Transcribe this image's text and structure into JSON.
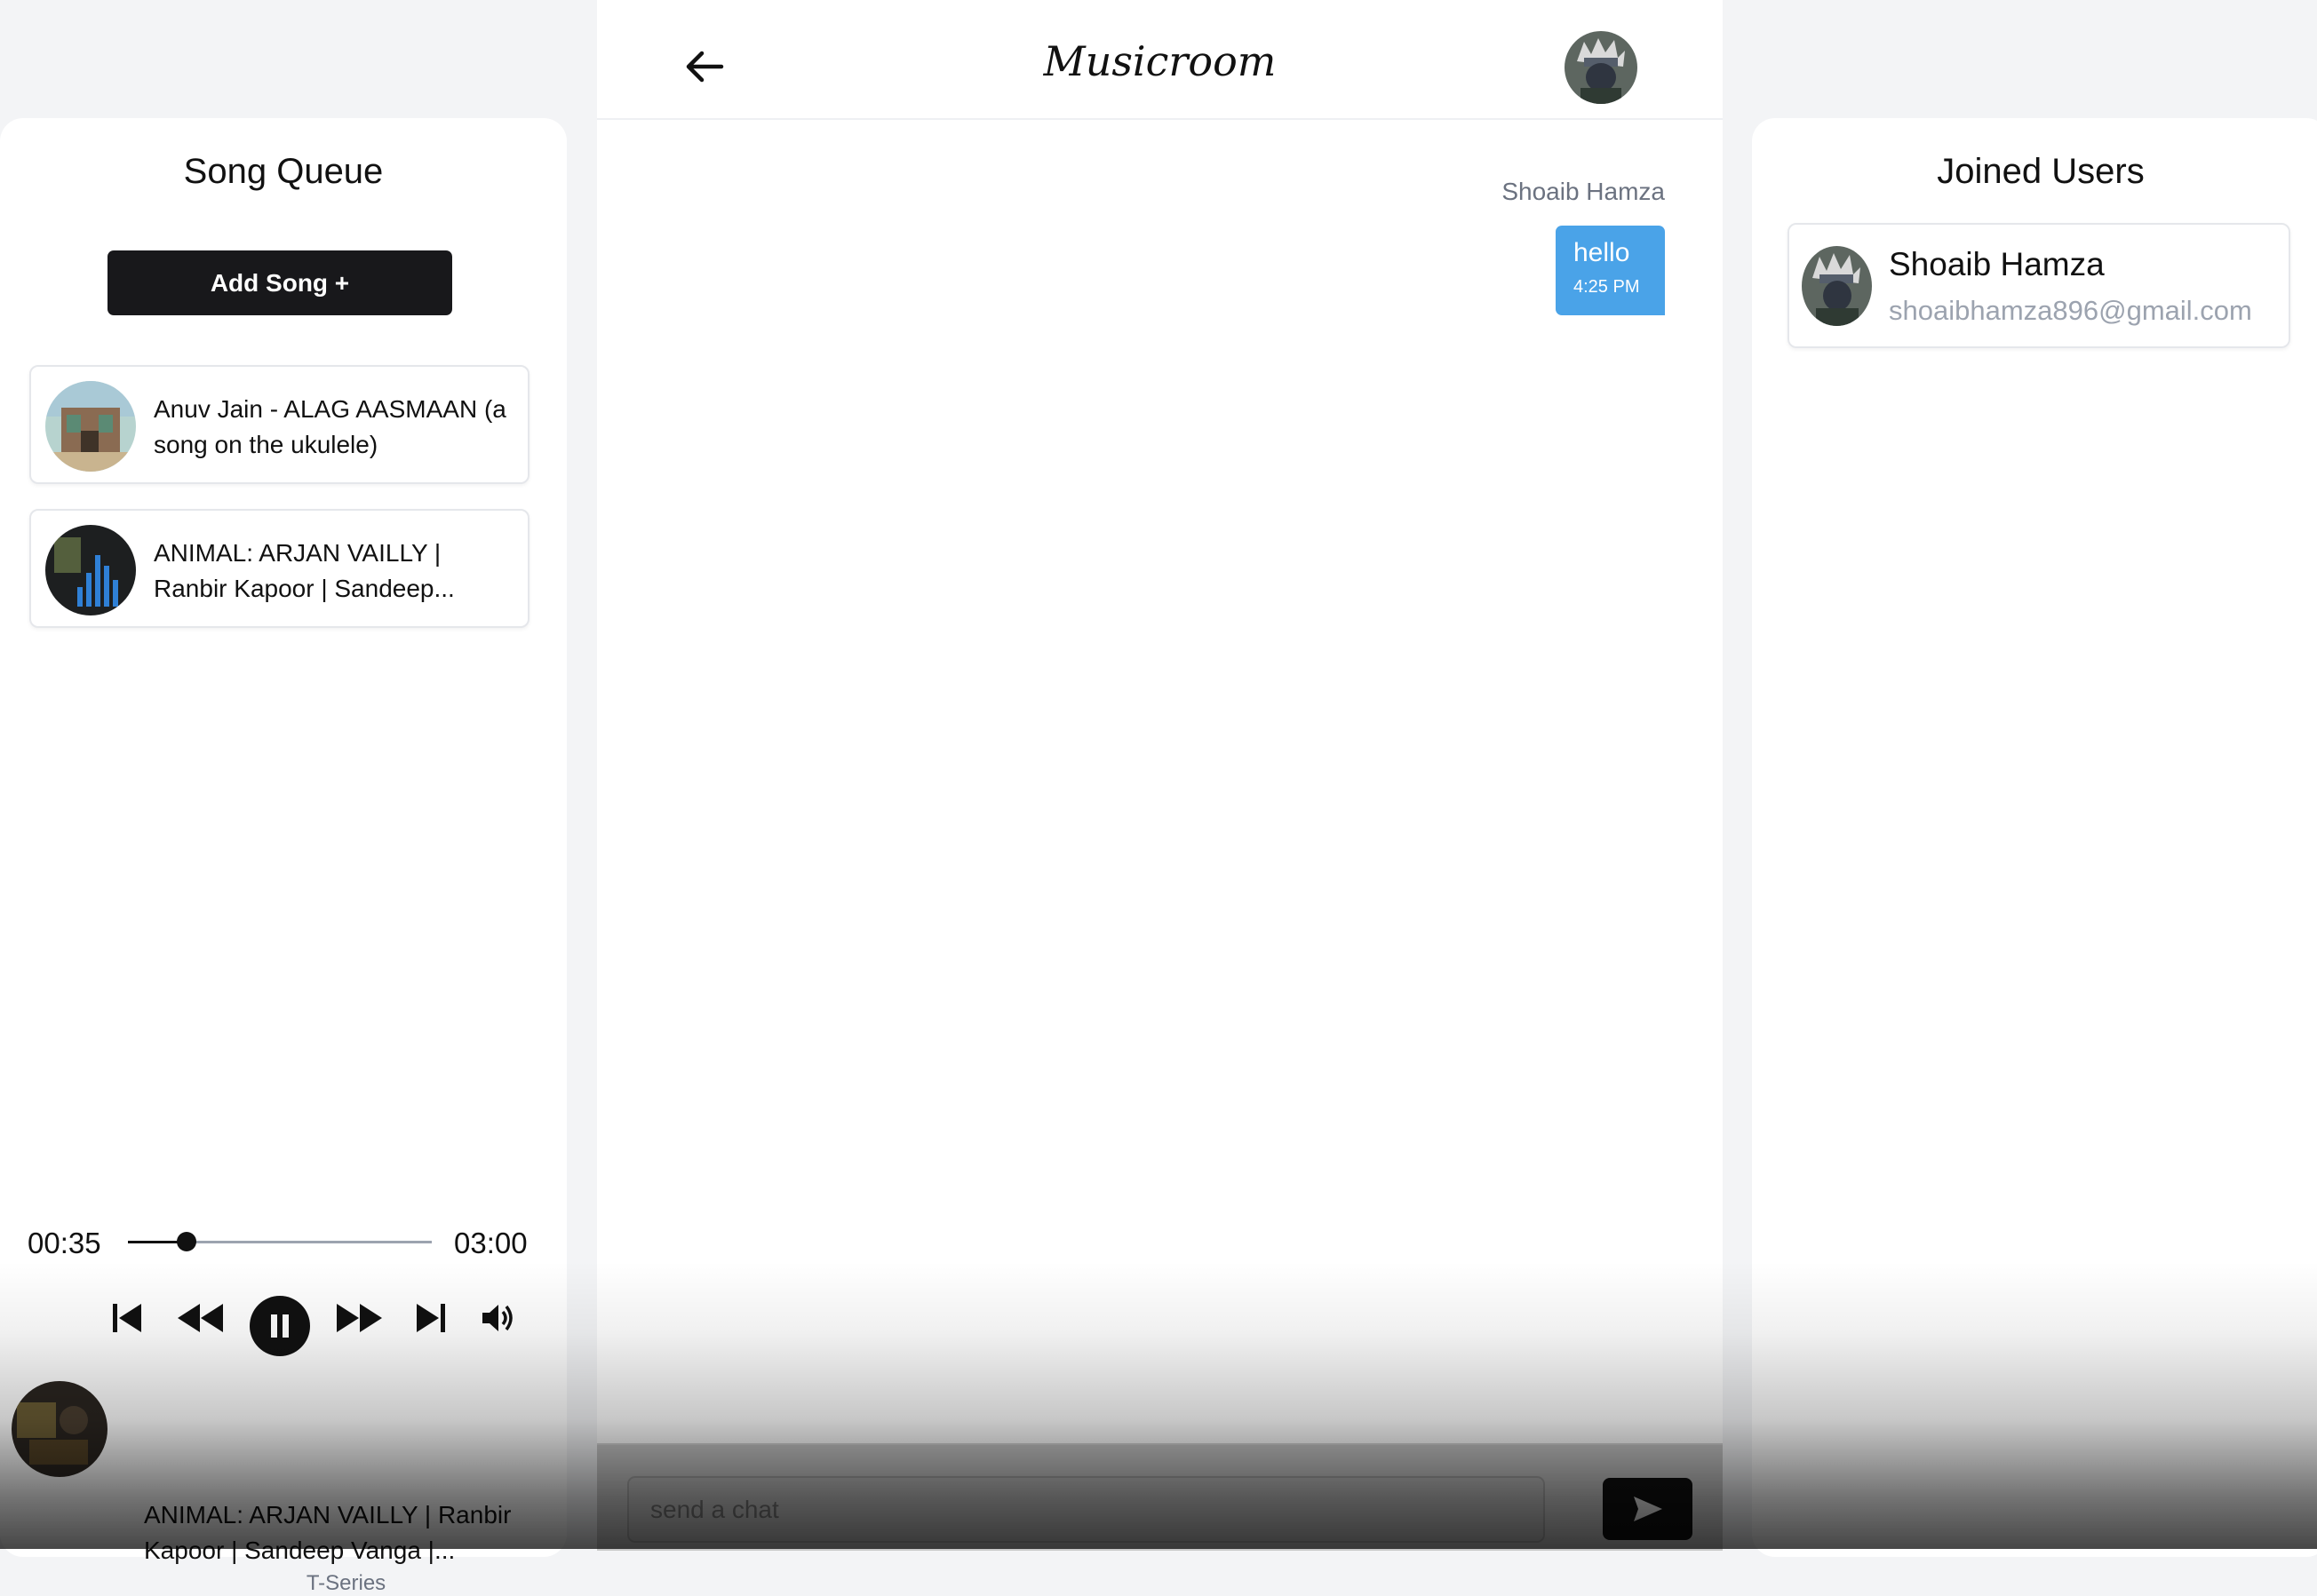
{
  "app": {
    "title": "Musicroom"
  },
  "queue": {
    "title": "Song Queue",
    "add_song_label": "Add Song +",
    "items": [
      {
        "title": "Anuv Jain - ALAG AASMAAN (a song on the ukulele)"
      },
      {
        "title": "ANIMAL: ARJAN VAILLY | Ranbir Kapoor | Sandeep..."
      }
    ]
  },
  "player": {
    "current_time": "00:35",
    "duration": "03:00",
    "progress": 0.194,
    "now_playing": {
      "title": "ANIMAL: ARJAN VAILLY | Ranbir Kapoor | Sandeep Vanga |...",
      "artist": "T-Series"
    },
    "controls": [
      "skip-previous-icon",
      "rewind-icon",
      "pause-icon",
      "fast-forward-icon",
      "skip-next-icon",
      "volume-icon"
    ]
  },
  "chat": {
    "messages": [
      {
        "sender": "Shoaib Hamza",
        "text": "hello",
        "time": "4:25 PM"
      }
    ],
    "input_placeholder": "send a chat"
  },
  "users": {
    "title": "Joined Users",
    "list": [
      {
        "name": "Shoaib Hamza",
        "email": "shoaibhamza896@gmail.com"
      }
    ]
  },
  "colors": {
    "bubble": "#4aa3e8",
    "button_dark": "#18181b",
    "page_bg": "#f3f4f6"
  }
}
